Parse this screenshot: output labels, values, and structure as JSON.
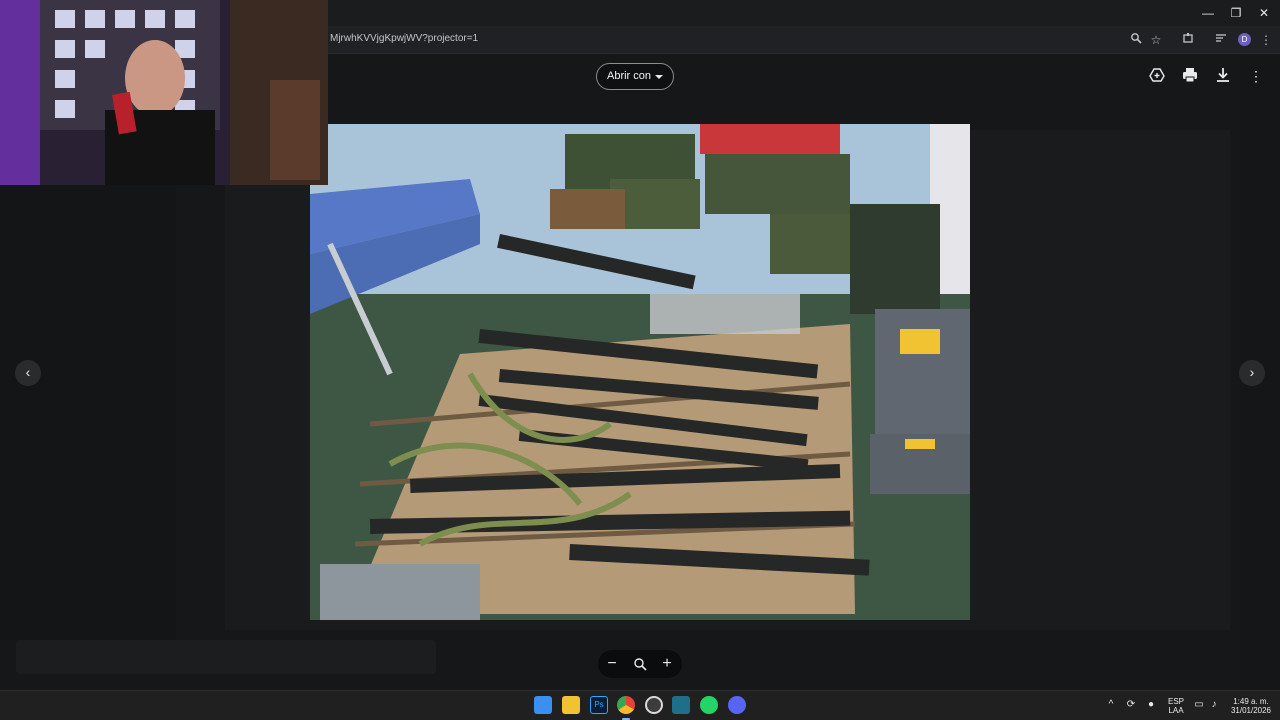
{
  "browser": {
    "url": "MjrwhKVVjgKpwjWV?projector=1",
    "window_controls": {
      "minimize": "—",
      "maximize": "❐",
      "close": "✕"
    },
    "toolbar_icons": [
      "zoom-icon",
      "star-icon",
      "extensions-icon",
      "cast-icon",
      "profile-icon",
      "menu-icon"
    ],
    "profile_initial": "D"
  },
  "viewer": {
    "open_with_label": "Abrir con",
    "actions": [
      "add-to-drive-icon",
      "print-icon",
      "download-icon",
      "more-options-icon"
    ],
    "prev_arrow": "‹",
    "next_arrow": "›",
    "zoom_out": "−",
    "zoom_reset": "⌕",
    "zoom_in": "+"
  },
  "taskbar": {
    "apps": [
      {
        "name": "start-icon",
        "color": "#3b8ff0"
      },
      {
        "name": "file-explorer-icon",
        "color": "#f1c232"
      },
      {
        "name": "photoshop-icon",
        "color": "#0a1d36"
      },
      {
        "name": "chrome-icon",
        "color": "#e94235"
      },
      {
        "name": "obs-icon",
        "color": "#3c3c3c"
      },
      {
        "name": "app-icon",
        "color": "#1f6f8b"
      },
      {
        "name": "whatsapp-icon",
        "color": "#25d366"
      },
      {
        "name": "discord-icon",
        "color": "#5865f2"
      }
    ],
    "language": "ESP",
    "language_region": "LAA",
    "time": "1:49 a. m.",
    "date": "31/01/2026"
  },
  "colors": {
    "accent": "#8ab4f8",
    "background": "#111214"
  }
}
